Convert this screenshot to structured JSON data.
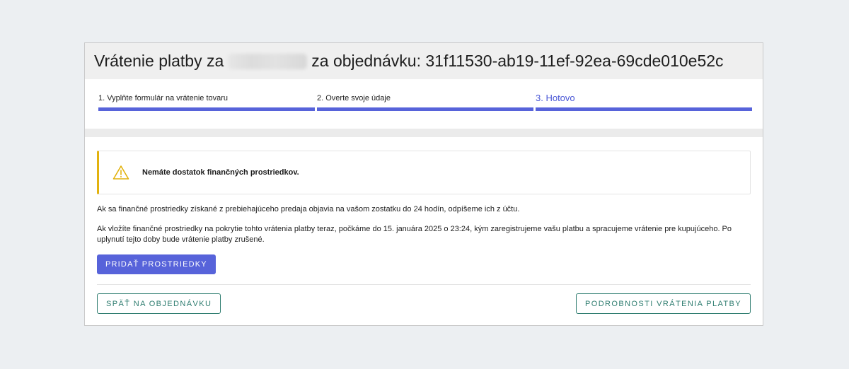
{
  "header": {
    "title_prefix": "Vrátenie platby za",
    "title_suffix": "za objednávku: 31f11530-ab19-11ef-92ea-69cde010e52c"
  },
  "steps": [
    {
      "label": "1. Vyplňte formulár na vrátenie tovaru",
      "active": false
    },
    {
      "label": "2. Overte svoje údaje",
      "active": false
    },
    {
      "label": "3. Hotovo",
      "active": true
    }
  ],
  "alert": {
    "icon": "warning-triangle-icon",
    "message": "Nemáte dostatok finančných prostriedkov."
  },
  "info": {
    "paragraph1": "Ak sa finančné prostriedky získané z prebiehajúceho predaja objavia na vašom zostatku do 24 hodín, odpíšeme ich z účtu.",
    "paragraph2": "Ak vložíte finančné prostriedky na pokrytie tohto vrátenia platby teraz, počkáme do 15. januára 2025 o 23:24, kým zaregistrujeme vašu platbu a spracujeme vrátenie pre kupujúceho. Po uplynutí tejto doby bude vrátenie platby zrušené."
  },
  "buttons": {
    "add_funds": "PRIDAŤ PROSTRIEDKY",
    "back_to_order": "SPÄŤ NA OBJEDNÁVKU",
    "refund_details": "PODROBNOSTI VRÁTENIA PLATBY"
  },
  "colors": {
    "accent": "#5763da",
    "outline": "#2f7d70",
    "warning": "#e2b20e"
  }
}
